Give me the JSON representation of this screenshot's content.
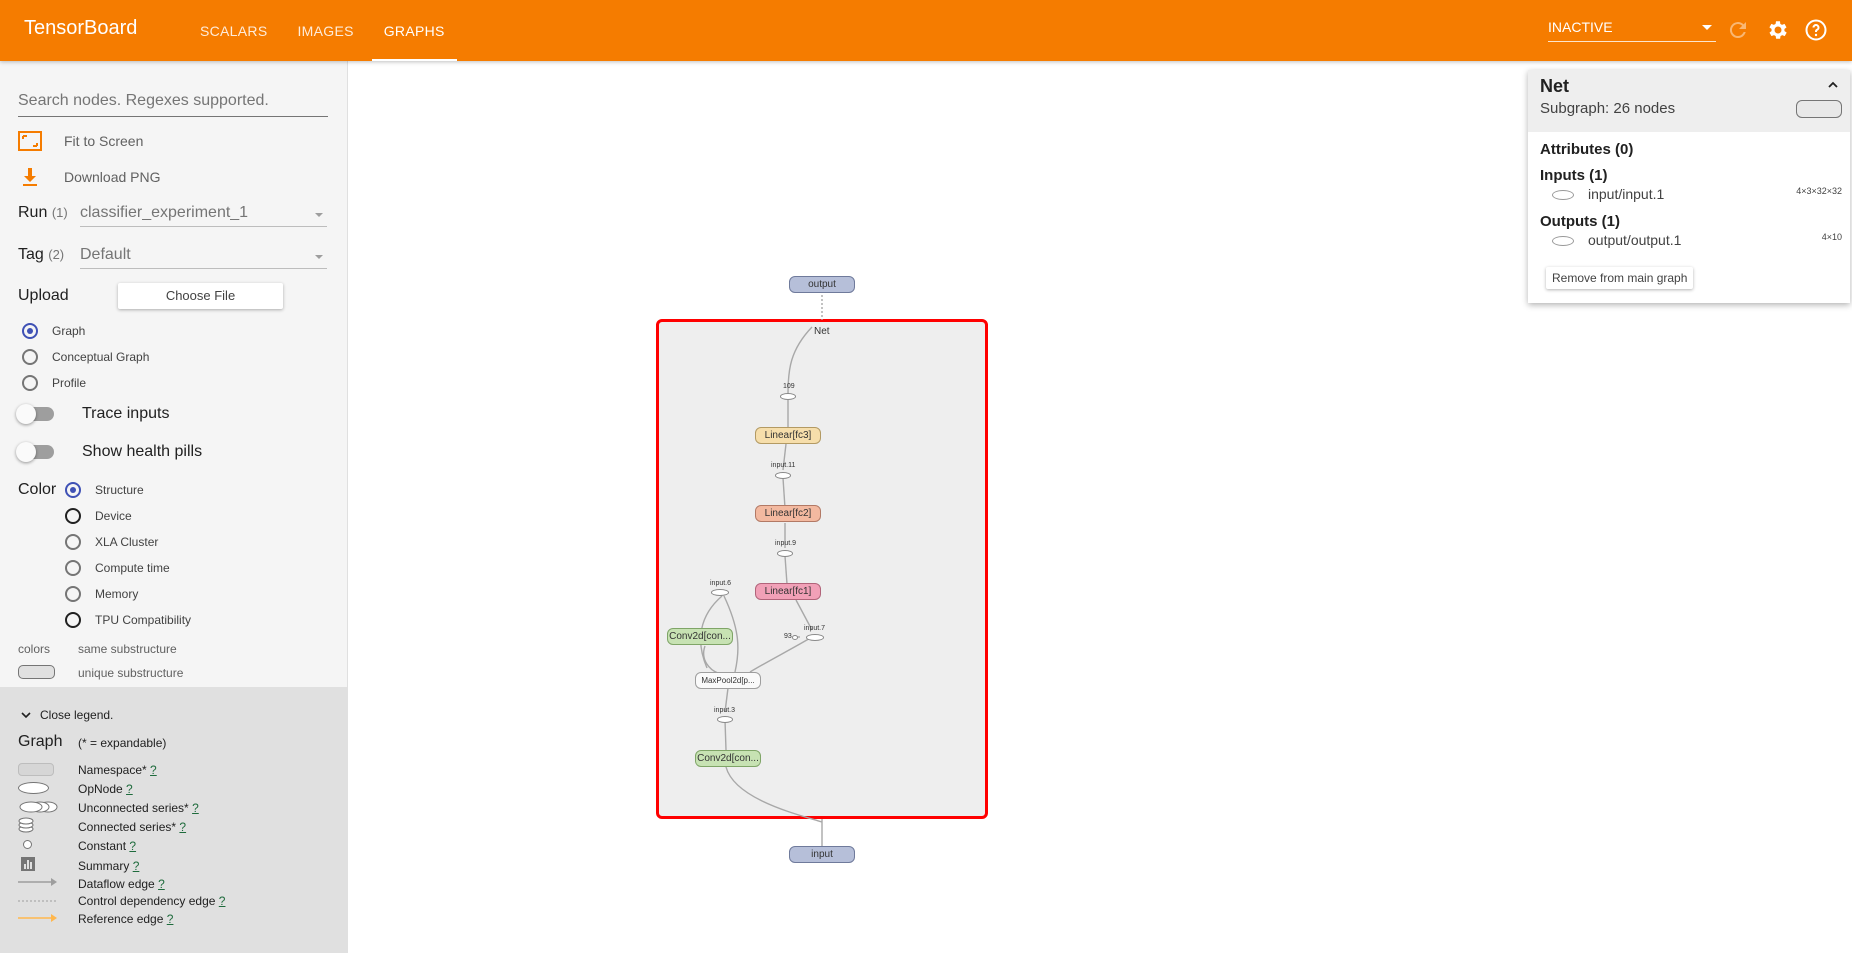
{
  "header": {
    "brand": "TensorBoard",
    "tabs": [
      {
        "label": "SCALARS"
      },
      {
        "label": "IMAGES"
      },
      {
        "label": "GRAPHS"
      }
    ],
    "status": "INACTIVE",
    "accent_color": "#f57c00"
  },
  "sidebar": {
    "search_placeholder": "Search nodes. Regexes supported.",
    "fit_to_screen": "Fit to Screen",
    "download_png": "Download PNG",
    "run_label": "Run",
    "run_count": "(1)",
    "run_value": "classifier_experiment_1",
    "tag_label": "Tag",
    "tag_count": "(2)",
    "tag_value": "Default",
    "upload_label": "Upload",
    "choose_file": "Choose File",
    "graph_modes": [
      "Graph",
      "Conceptual Graph",
      "Profile"
    ],
    "trace_inputs": "Trace inputs",
    "show_health_pills": "Show health pills",
    "color_label": "Color",
    "color_modes": [
      "Structure",
      "Device",
      "XLA Cluster",
      "Compute time",
      "Memory",
      "TPU Compatibility"
    ],
    "colors_label": "colors",
    "same_substructure": "same substructure",
    "unique_substructure": "unique substructure"
  },
  "legend": {
    "close": "Close legend.",
    "graph": "Graph",
    "expandable": "(* = expandable)",
    "help": "?",
    "items": [
      "Namespace*",
      "OpNode",
      "Unconnected series*",
      "Connected series*",
      "Constant",
      "Summary",
      "Dataflow edge",
      "Control dependency edge",
      "Reference edge"
    ]
  },
  "graph": {
    "output": "output",
    "input": "input",
    "net": "Net",
    "n109": "109",
    "fc3": "Linear[fc3]",
    "input11": "input.11",
    "fc2": "Linear[fc2]",
    "input9": "input.9",
    "fc1": "Linear[fc1]",
    "input6": "input.6",
    "input7": "input.7",
    "conv_a": "Conv2d[con...",
    "s93": "93",
    "maxpool": "MaxPool2d[p...",
    "input3": "input.3",
    "conv_b": "Conv2d[con..."
  },
  "info": {
    "title": "Net",
    "subgraph": "Subgraph: 26 nodes",
    "attributes": "Attributes (0)",
    "inputs": "Inputs (1)",
    "input_item": "input/input.1",
    "input_dim": "4×3×32×32",
    "outputs": "Outputs (1)",
    "output_item": "output/output.1",
    "output_dim": "4×10",
    "remove": "Remove from main graph"
  }
}
